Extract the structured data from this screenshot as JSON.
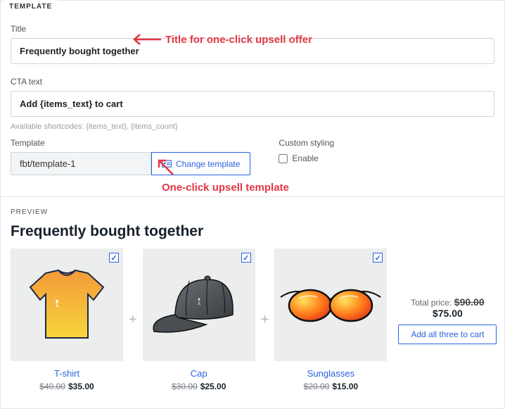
{
  "template": {
    "section_label": "TEMPLATE",
    "title_label": "Title",
    "title_value": "Frequently bought together",
    "cta_label": "CTA text",
    "cta_value": "Add {items_text} to cart",
    "shortcodes_help": "Available shortcodes: {items_text}, {items_count}",
    "template_label": "Template",
    "template_value": "fbt/template-1",
    "change_btn": "Change template",
    "custom_styling_label": "Custom styling",
    "enable_label": "Enable"
  },
  "annotations": {
    "title_note": "Title for one-click upsell offer",
    "template_note": "One-click upsell template"
  },
  "preview": {
    "section_label": "PREVIEW",
    "heading": "Frequently bought together",
    "products": [
      {
        "name": "T-shirt",
        "old_price": "$40.00",
        "price": "$35.00"
      },
      {
        "name": "Cap",
        "old_price": "$30.00",
        "price": "$25.00"
      },
      {
        "name": "Sunglasses",
        "old_price": "$20.00",
        "price": "$15.00"
      }
    ],
    "total_label": "Total price:",
    "total_old": "$90.00",
    "total_new": "$75.00",
    "add_all_btn": "Add all three to cart"
  }
}
